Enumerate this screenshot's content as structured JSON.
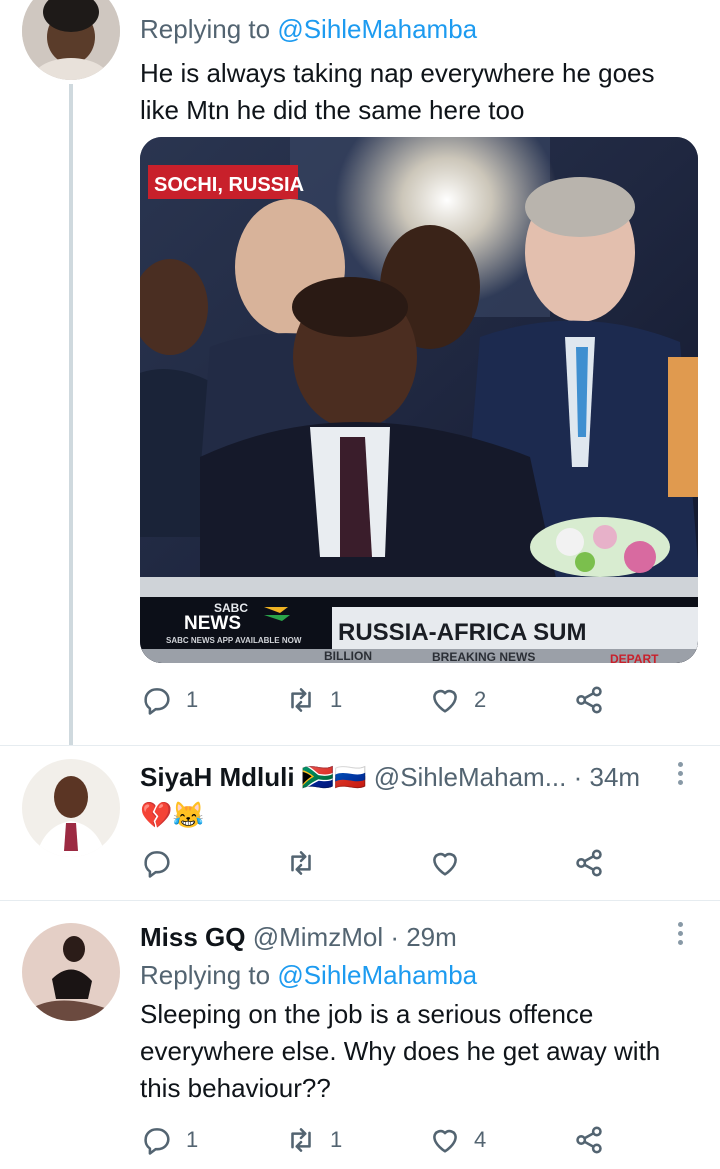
{
  "tweet1": {
    "replying_prefix": "Replying to ",
    "replying_mention": "@SihleMahamba",
    "text": "He is always taking nap everywhere he goes like Mtn he did the same here too",
    "media": {
      "location_tag": "SOCHI, RUSSIA",
      "logo_top": "SABC",
      "logo_main": "NEWS",
      "logo_sub": "SABC NEWS APP AVAILABLE NOW",
      "banner": "RUSSIA-AFRICA SUM",
      "ticker_1": "BILLION",
      "ticker_2": "BREAKING NEWS",
      "ticker_3": "DEPART"
    },
    "reply_count": "1",
    "retweet_count": "1",
    "like_count": "2"
  },
  "tweet2": {
    "name": "SiyaH Mdluli",
    "flags": "🇿🇦🇷🇺",
    "handle": "@SihleMaham...",
    "time": "· 34m",
    "text": "💔😹"
  },
  "tweet3": {
    "name": "Miss GQ",
    "handle": "@MimzMol",
    "time": "· 29m",
    "replying_prefix": "Replying to ",
    "replying_mention": "@SihleMahamba",
    "text": "Sleeping on the job is a serious offence everywhere else. Why does he get away with this behaviour??",
    "reply_count": "1",
    "retweet_count": "1",
    "like_count": "4"
  },
  "colors": {
    "accent": "#1d9bf0",
    "secondary_text": "#536471",
    "thread_line": "#cfd9de",
    "news_red": "#c8202b"
  },
  "icons": [
    "reply-icon",
    "retweet-icon",
    "like-icon",
    "share-icon",
    "more-icon"
  ]
}
